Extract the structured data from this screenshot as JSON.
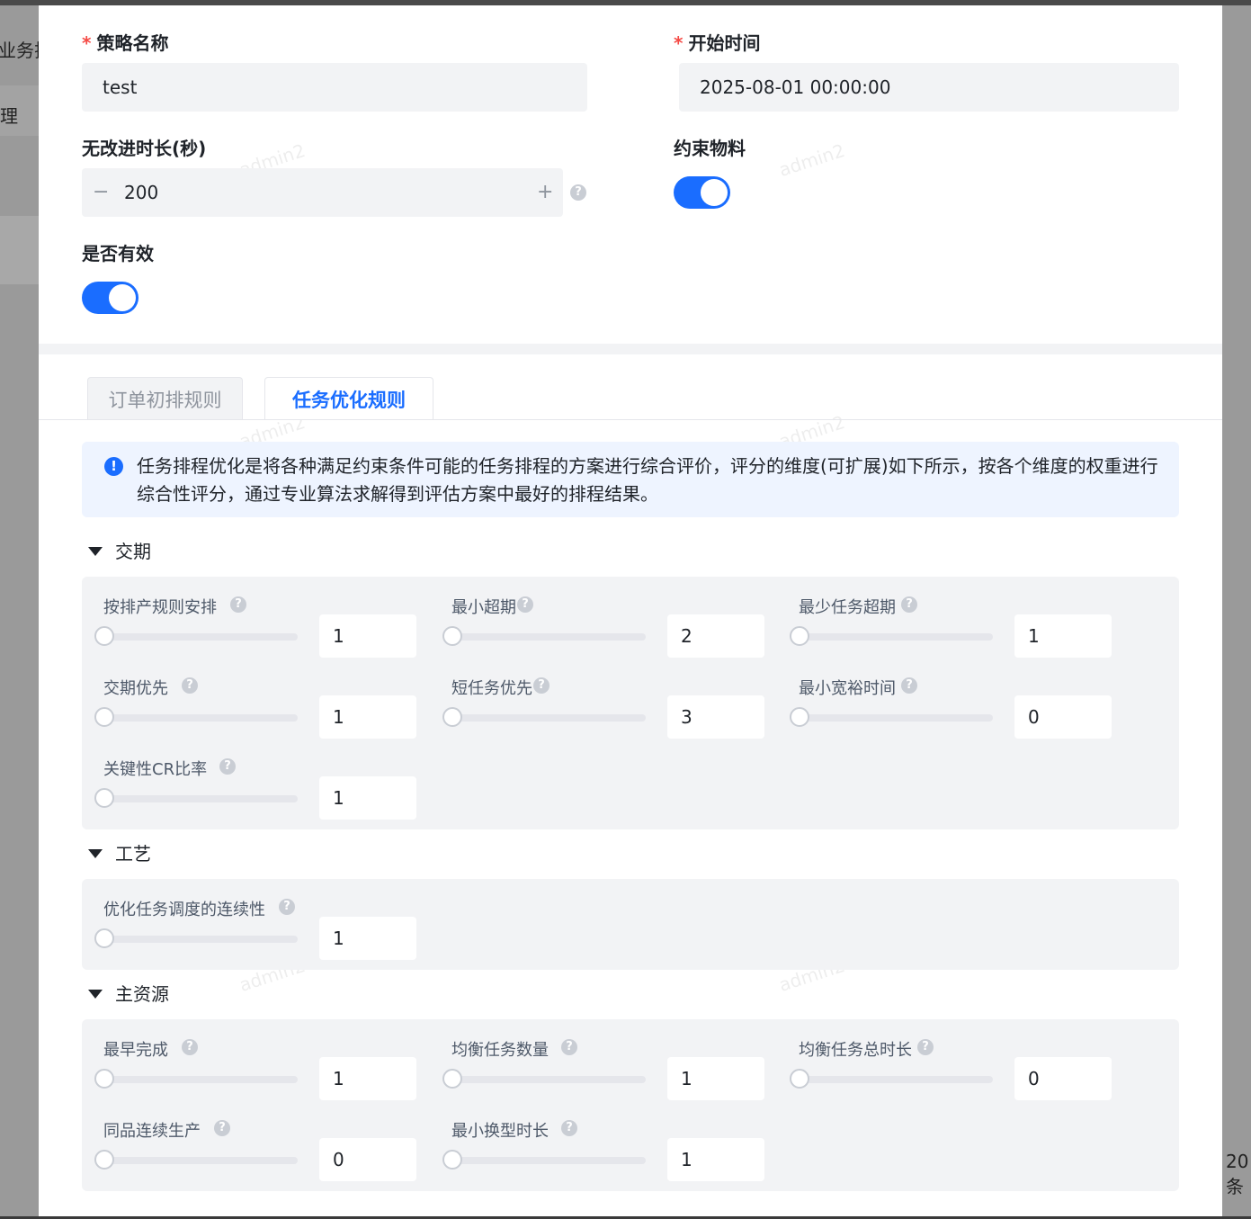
{
  "background": {
    "fragment_left_1": "业务排",
    "fragment_left_2": "理",
    "fragment_right": "20条"
  },
  "watermark": "admin2",
  "form": {
    "strategy_name": {
      "label": "策略名称",
      "required": true,
      "value": "test"
    },
    "start_time": {
      "label": "开始时间",
      "required": true,
      "value": "2025-08-01 00:00:00"
    },
    "no_improve_duration": {
      "label": "无改进时长(秒)",
      "value": "200",
      "minus": "−",
      "plus": "+"
    },
    "constraint_material": {
      "label": "约束物料",
      "on": true
    },
    "is_valid": {
      "label": "是否有效",
      "on": true
    }
  },
  "tabs": [
    {
      "label": "订单初排规则",
      "active": false
    },
    {
      "label": "任务优化规则",
      "active": true
    }
  ],
  "alert": {
    "icon": "info-icon",
    "text": "任务排程优化是将各种满足约束条件可能的任务排程的方案进行综合评价，评分的维度(可扩展)如下所示，按各个维度的权重进行综合性评分，通过专业算法求解得到评估方案中最好的排程结果。"
  },
  "help_glyph": "?",
  "alert_glyph": "!",
  "sections": [
    {
      "title": "交期",
      "items": [
        {
          "label": "按排产规则安排",
          "value": "1"
        },
        {
          "label": "最小超期",
          "value": "2"
        },
        {
          "label": "最少任务超期",
          "value": "1"
        },
        {
          "label": "交期优先",
          "value": "1"
        },
        {
          "label": "短任务优先",
          "value": "3"
        },
        {
          "label": "最小宽裕时间",
          "value": "0"
        },
        {
          "label": "关键性CR比率",
          "value": "1"
        }
      ]
    },
    {
      "title": "工艺",
      "items": [
        {
          "label": "优化任务调度的连续性",
          "value": "1"
        }
      ]
    },
    {
      "title": "主资源",
      "items": [
        {
          "label": "最早完成",
          "value": "1"
        },
        {
          "label": "均衡任务数量",
          "value": "1"
        },
        {
          "label": "均衡任务总时长",
          "value": "0"
        },
        {
          "label": "同品连续生产",
          "value": "0"
        },
        {
          "label": "最小换型时长",
          "value": "1"
        }
      ]
    }
  ],
  "colors": {
    "primary": "#1a6dff",
    "required": "#f54a45",
    "panel": "#f2f3f5"
  }
}
